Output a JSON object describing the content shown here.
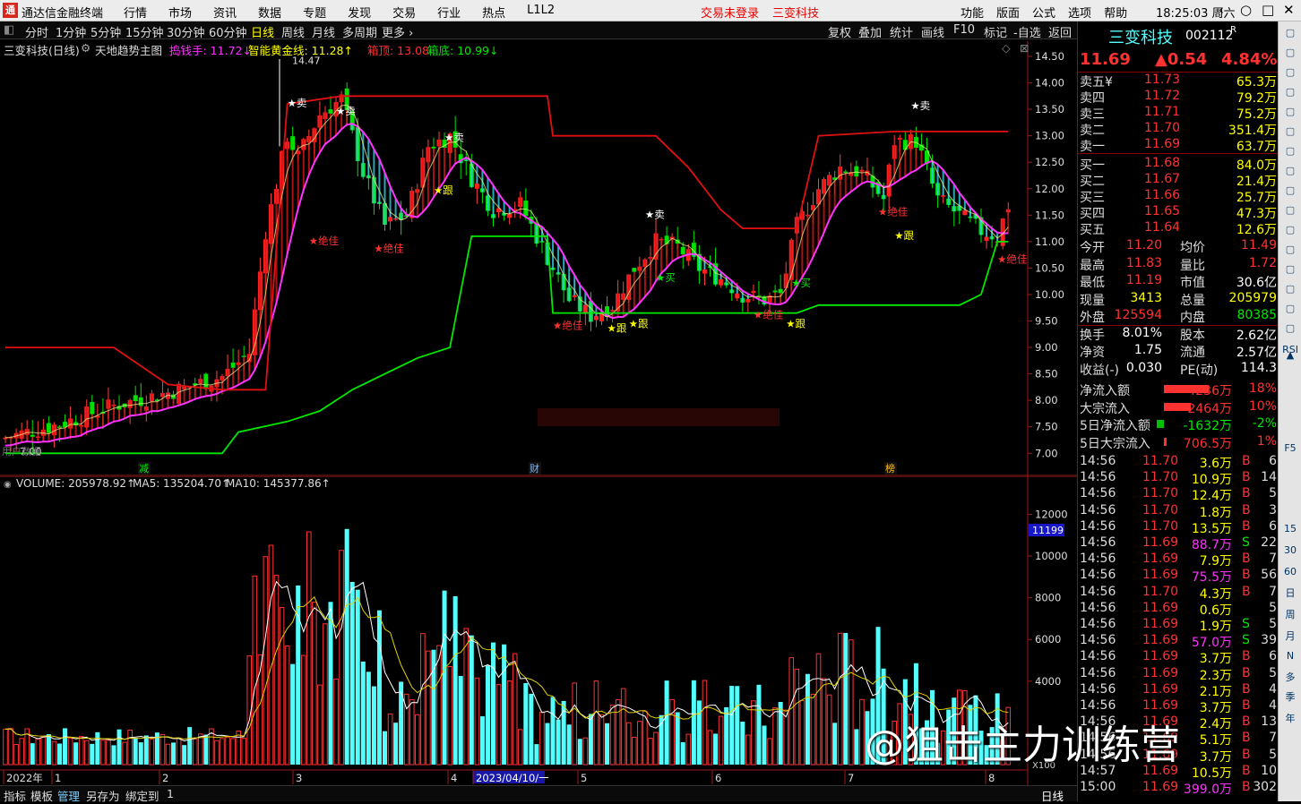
{
  "app": {
    "title": "通达信金融终端",
    "logo": "通",
    "menu": [
      "行情",
      "市场",
      "资讯",
      "数据",
      "专题",
      "发现",
      "交易",
      "行业",
      "热点",
      "L1L2"
    ],
    "notice_login": "交易未登录",
    "notice_stock": "三变科技",
    "right_menu": [
      "功能",
      "版面",
      "公式",
      "选项",
      "帮助"
    ],
    "time": "18:25:03",
    "weekday": "周六",
    "win_buttons": [
      "‹",
      "○",
      "□",
      "✕"
    ]
  },
  "periods": {
    "items": [
      "分时",
      "1分钟",
      "5分钟",
      "15分钟",
      "30分钟",
      "60分钟",
      "日线",
      "周线",
      "月线",
      "多周期",
      "更多 ›"
    ],
    "selected": "日线",
    "right": [
      "复权",
      "叠加",
      "统计",
      "画线",
      "F10",
      "标记",
      "-自选",
      "返回"
    ]
  },
  "chart": {
    "title": "三变科技(日线)",
    "formula": "天地趋势主图",
    "f1": "捣钱手: 11.72↓",
    "f2": "智能黄金线: 11.28↑",
    "f3": "箱顶: 13.08",
    "f4": "箱底: 10.99↓",
    "price_ticks": [
      "14.50",
      "14.00",
      "13.50",
      "13.00",
      "12.50",
      "12.00",
      "11.50",
      "11.00",
      "10.50",
      "10.00",
      "9.50",
      "9.00",
      "8.50",
      "8.00",
      "7.50",
      "7.00"
    ],
    "high_label": "14.47",
    "low_label": "7.00",
    "corner": "用户数据",
    "markers": {
      "sell": "★卖",
      "buy": "★买",
      "follow": "★跟",
      "best": "★绝佳"
    },
    "bottom_tags": [
      "减",
      "财",
      "榜"
    ]
  },
  "volume": {
    "label": "VOLUME: 205978.92↑",
    "ma5": "MA5: 135204.70↑",
    "ma10": "MA10: 145377.86↑",
    "ticks": [
      "12000",
      "10000",
      "8000",
      "6000",
      "4000"
    ],
    "current_box": "11199",
    "unit": "X100"
  },
  "axis": {
    "labels": [
      "2022年",
      "1",
      "2",
      "3",
      "4",
      "2023/04/10/一",
      "5",
      "6",
      "7",
      "8"
    ],
    "right_label": "日线"
  },
  "bottom_tabs": [
    "指标",
    "模板",
    "管理",
    "另存为",
    "绑定到",
    "1"
  ],
  "colors": {
    "up": "#ff3232",
    "down": "#54ffff",
    "green_box": "#00e800",
    "magenta": "#ff33ff",
    "resist": "#e01010"
  },
  "stock": {
    "name": "三变科技",
    "code": "002112",
    "suffix": "R",
    "price": "11.69",
    "change": "▲0.54",
    "pct": "4.84%"
  },
  "orderbook": [
    {
      "label": "卖五",
      "extra": "¥",
      "price": "11.73",
      "vol": "65.3万"
    },
    {
      "label": "卖四",
      "price": "11.72",
      "vol": "79.2万"
    },
    {
      "label": "卖三",
      "price": "11.71",
      "vol": "75.2万"
    },
    {
      "label": "卖二",
      "price": "11.70",
      "vol": "351.4万"
    },
    {
      "label": "卖一",
      "price": "11.69",
      "vol": "63.7万"
    },
    {
      "label": "买一",
      "price": "11.68",
      "vol": "84.0万"
    },
    {
      "label": "买二",
      "price": "11.67",
      "vol": "21.4万"
    },
    {
      "label": "买三",
      "price": "11.66",
      "vol": "25.7万"
    },
    {
      "label": "买四",
      "price": "11.65",
      "vol": "47.3万"
    },
    {
      "label": "买五",
      "price": "11.64",
      "vol": "12.6万"
    }
  ],
  "stats": [
    {
      "l1": "今开",
      "v1": "11.20",
      "l2": "均价",
      "v2": "11.49"
    },
    {
      "l1": "最高",
      "v1": "11.83",
      "l2": "量比",
      "v2": "1.72"
    },
    {
      "l1": "最低",
      "v1": "11.19",
      "l2": "市值",
      "v2": "30.6亿"
    },
    {
      "l1": "现量",
      "v1": "3413",
      "l2": "总量",
      "v2": "205979"
    },
    {
      "l1": "外盘",
      "v1": "125594",
      "l2": "内盘",
      "v2": "80385"
    },
    {
      "l1": "换手",
      "v1": "8.01%",
      "l2": "股本",
      "v2": "2.62亿"
    },
    {
      "l1": "净资",
      "v1": "1.75",
      "l2": "流通",
      "v2": "2.57亿"
    },
    {
      "l1": "收益(-)",
      "v1": "0.030",
      "l2": "PE(动)",
      "v2": "114.3"
    }
  ],
  "flows": [
    {
      "label": "净流入额",
      "value": "4236万",
      "pct": "18%"
    },
    {
      "label": "大宗流入",
      "value": "2464万",
      "pct": "10%"
    },
    {
      "label": "5日净流入额",
      "value": "-1632万",
      "pct": "-2%"
    },
    {
      "label": "5日大宗流入",
      "value": "706.5万",
      "pct": "1%"
    }
  ],
  "ticks": [
    {
      "t": "14:56",
      "p": "11.70",
      "v": "3.6万",
      "bs": "B",
      "n": "6"
    },
    {
      "t": "14:56",
      "p": "11.70",
      "v": "10.9万",
      "bs": "B",
      "n": "14"
    },
    {
      "t": "14:56",
      "p": "11.70",
      "v": "12.4万",
      "bs": "B",
      "n": "5"
    },
    {
      "t": "14:56",
      "p": "11.70",
      "v": "1.8万",
      "bs": "B",
      "n": "3"
    },
    {
      "t": "14:56",
      "p": "11.70",
      "v": "13.5万",
      "bs": "B",
      "n": "6"
    },
    {
      "t": "14:56",
      "p": "11.69",
      "v": "88.7万",
      "bs": "S",
      "n": "22"
    },
    {
      "t": "14:56",
      "p": "11.69",
      "v": "7.9万",
      "bs": "B",
      "n": "7"
    },
    {
      "t": "14:56",
      "p": "11.69",
      "v": "75.5万",
      "bs": "B",
      "n": "56"
    },
    {
      "t": "14:56",
      "p": "11.70",
      "v": "4.3万",
      "bs": "B",
      "n": "7"
    },
    {
      "t": "14:56",
      "p": "11.69",
      "v": "0.6万",
      "bs": "",
      "n": "5"
    },
    {
      "t": "14:56",
      "p": "11.69",
      "v": "1.9万",
      "bs": "S",
      "n": "5"
    },
    {
      "t": "14:56",
      "p": "11.69",
      "v": "57.0万",
      "bs": "S",
      "n": "39"
    },
    {
      "t": "14:56",
      "p": "11.69",
      "v": "3.7万",
      "bs": "B",
      "n": "6"
    },
    {
      "t": "14:56",
      "p": "11.69",
      "v": "2.3万",
      "bs": "B",
      "n": "5"
    },
    {
      "t": "14:56",
      "p": "11.69",
      "v": "2.1万",
      "bs": "B",
      "n": "4"
    },
    {
      "t": "14:56",
      "p": "11.69",
      "v": "3.7万",
      "bs": "B",
      "n": "4"
    },
    {
      "t": "14:56",
      "p": "11.69",
      "v": "2.4万",
      "bs": "B",
      "n": "13"
    },
    {
      "t": "14:56",
      "p": "11.69",
      "v": "5.1万",
      "bs": "B",
      "n": "7"
    },
    {
      "t": "14:56",
      "p": "11.69",
      "v": "3.7万",
      "bs": "B",
      "n": "5"
    },
    {
      "t": "14:57",
      "p": "11.69",
      "v": "10.5万",
      "bs": "B",
      "n": "10"
    },
    {
      "t": "15:00",
      "p": "11.69",
      "v": "399.0万",
      "bs": "B",
      "n": "302"
    }
  ],
  "watermark": "@狙击主力训练营",
  "side_tools": [
    "▲",
    "RSI",
    "15",
    "30",
    "60",
    "日",
    "周",
    "月",
    "N",
    "多",
    "季",
    "年",
    "F5"
  ],
  "chart_data": {
    "type": "candlestick",
    "note_ylim": [
      7.0,
      14.5
    ],
    "high": 14.47,
    "low": 7.0,
    "box_top": 13.08,
    "box_bottom": 10.99,
    "golden_line": 11.28,
    "last_close": 11.69
  }
}
